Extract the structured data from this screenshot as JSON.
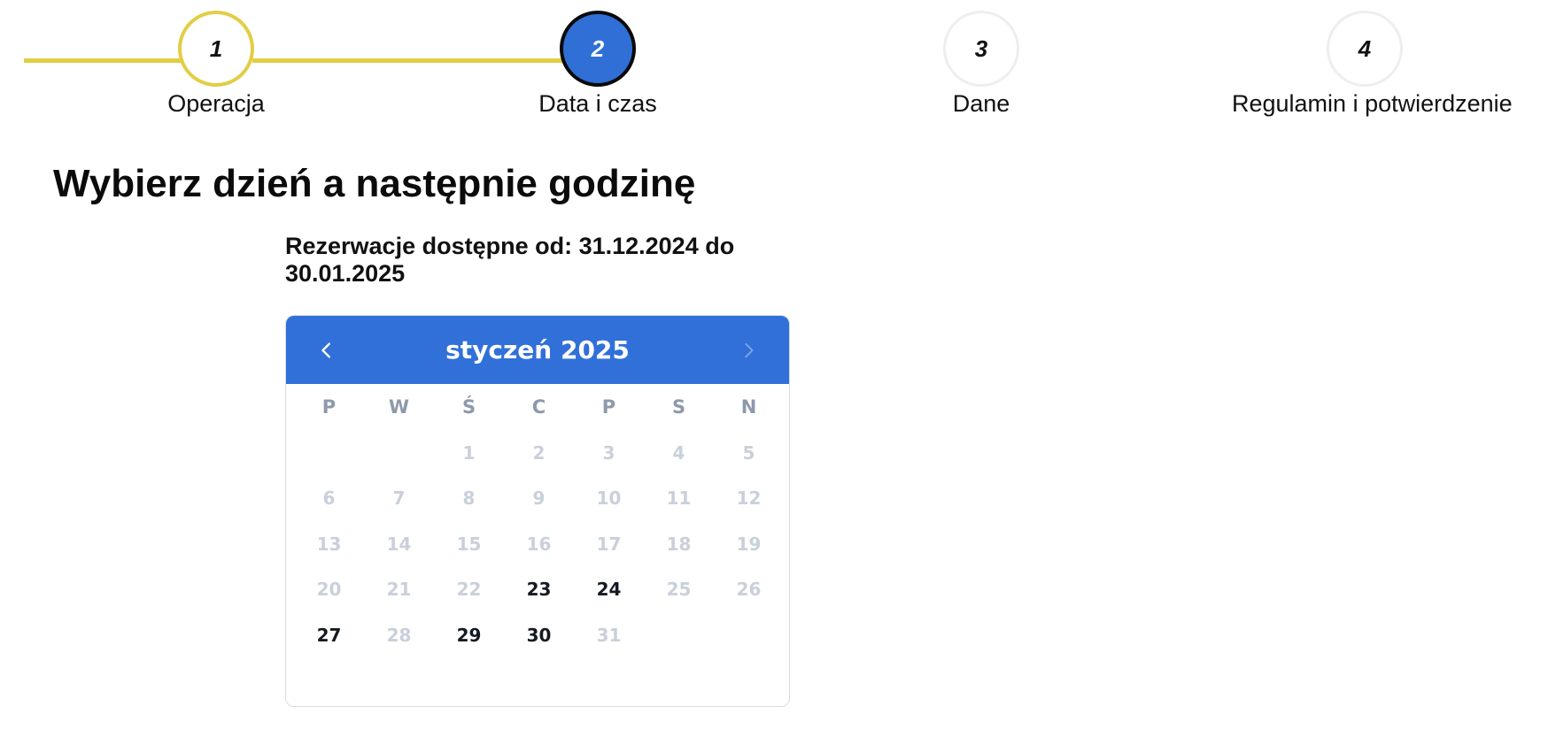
{
  "stepper": {
    "steps": [
      {
        "number": "1",
        "label": "Operacja",
        "state": "done"
      },
      {
        "number": "2",
        "label": "Data i czas",
        "state": "active"
      },
      {
        "number": "3",
        "label": "Dane",
        "state": "pending"
      },
      {
        "number": "4",
        "label": "Regulamin i potwierdzenie",
        "state": "pending"
      }
    ],
    "colors": {
      "done": "#e2cd45",
      "active": "#2f6fd6"
    }
  },
  "page": {
    "title": "Wybierz dzień a następnie godzinę",
    "availability": "Rezerwacje dostępne od: 31.12.2024 do 30.01.2025"
  },
  "calendar": {
    "month_label": "styczeń 2025",
    "prev_icon": "chevron-left-icon",
    "next_icon": "chevron-right-icon",
    "header_color": "#3070d8",
    "weekdays": [
      "P",
      "W",
      "Ś",
      "C",
      "P",
      "S",
      "N"
    ],
    "weeks": [
      [
        {
          "d": "",
          "s": "empty"
        },
        {
          "d": "",
          "s": "empty"
        },
        {
          "d": "1",
          "s": "disabled"
        },
        {
          "d": "2",
          "s": "disabled"
        },
        {
          "d": "3",
          "s": "disabled"
        },
        {
          "d": "4",
          "s": "disabled"
        },
        {
          "d": "5",
          "s": "disabled"
        }
      ],
      [
        {
          "d": "6",
          "s": "disabled"
        },
        {
          "d": "7",
          "s": "disabled"
        },
        {
          "d": "8",
          "s": "disabled"
        },
        {
          "d": "9",
          "s": "disabled"
        },
        {
          "d": "10",
          "s": "disabled"
        },
        {
          "d": "11",
          "s": "disabled"
        },
        {
          "d": "12",
          "s": "disabled"
        }
      ],
      [
        {
          "d": "13",
          "s": "disabled"
        },
        {
          "d": "14",
          "s": "disabled"
        },
        {
          "d": "15",
          "s": "disabled"
        },
        {
          "d": "16",
          "s": "disabled"
        },
        {
          "d": "17",
          "s": "disabled"
        },
        {
          "d": "18",
          "s": "disabled"
        },
        {
          "d": "19",
          "s": "disabled"
        }
      ],
      [
        {
          "d": "20",
          "s": "disabled"
        },
        {
          "d": "21",
          "s": "disabled"
        },
        {
          "d": "22",
          "s": "disabled"
        },
        {
          "d": "23",
          "s": "available"
        },
        {
          "d": "24",
          "s": "available"
        },
        {
          "d": "25",
          "s": "disabled"
        },
        {
          "d": "26",
          "s": "disabled"
        }
      ],
      [
        {
          "d": "27",
          "s": "available"
        },
        {
          "d": "28",
          "s": "disabled"
        },
        {
          "d": "29",
          "s": "available"
        },
        {
          "d": "30",
          "s": "available"
        },
        {
          "d": "31",
          "s": "disabled"
        },
        {
          "d": "",
          "s": "empty"
        },
        {
          "d": "",
          "s": "empty"
        }
      ]
    ]
  }
}
